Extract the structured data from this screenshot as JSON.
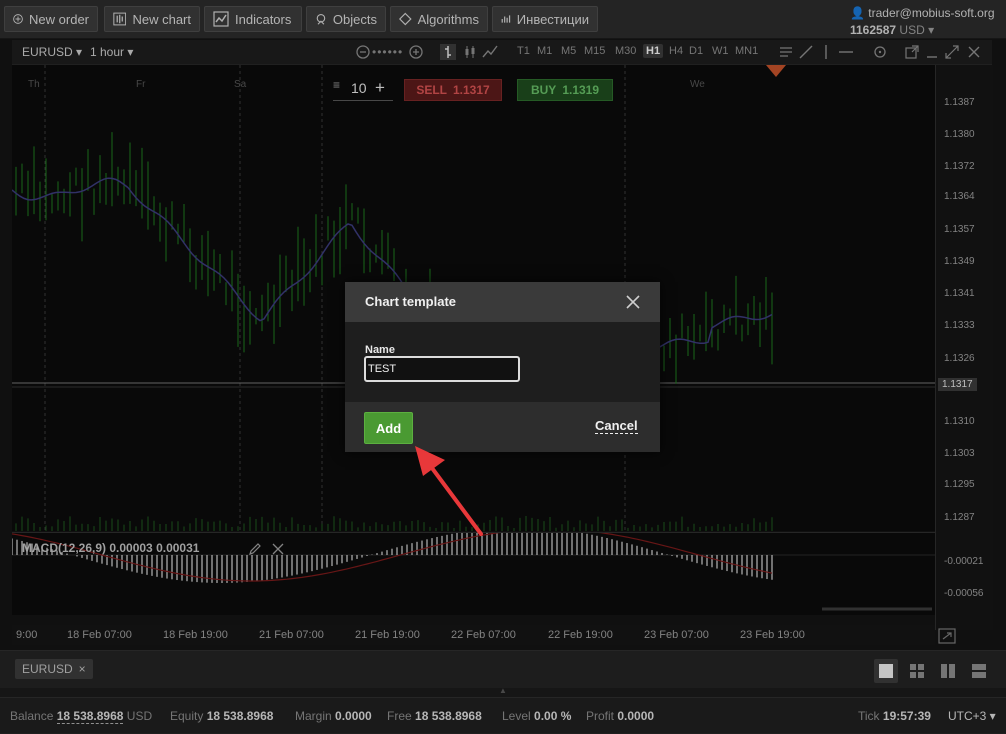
{
  "toolbar": {
    "new_order": "New order",
    "new_chart": "New chart",
    "indicators": "Indicators",
    "objects": "Objects",
    "algorithms": "Algorithms",
    "investments": "Инвестиции"
  },
  "account": {
    "email": "trader@mobius-soft.org",
    "number": "1162587",
    "currency": "USD"
  },
  "chart": {
    "symbol": "EURUSD",
    "interval": "1 hour",
    "timeframes": [
      "T1",
      "M1",
      "M5",
      "M15",
      "M30",
      "H1",
      "H4",
      "D1",
      "W1",
      "MN1"
    ],
    "active_timeframe": "H1",
    "day_labels": [
      "Th",
      "Fr",
      "Sa",
      "We"
    ],
    "price_labels": [
      "1.1387",
      "1.1380",
      "1.1372",
      "1.1364",
      "1.1357",
      "1.1349",
      "1.1341",
      "1.1333",
      "1.1326",
      "1.1310",
      "1.1303",
      "1.1295",
      "1.1287"
    ],
    "current_price": "1.1317",
    "macd_label": "MACD(12,26,9) 0.00003 0.00031",
    "macd_ticks": [
      "-0.00021",
      "-0.00056"
    ],
    "time_labels": [
      "9:00",
      "18 Feb 07:00",
      "18 Feb 19:00",
      "21 Feb 07:00",
      "21 Feb 19:00",
      "22 Feb 07:00",
      "22 Feb 19:00",
      "23 Feb 07:00",
      "23 Feb 19:00"
    ],
    "volume": "10",
    "sell_label": "SELL",
    "sell_price": "1.1317",
    "buy_label": "BUY",
    "buy_price": "1.1319"
  },
  "dialog": {
    "title": "Chart template",
    "name_label": "Name",
    "name_value": "TEST",
    "add": "Add",
    "cancel": "Cancel"
  },
  "tabs": {
    "symbol": "EURUSD"
  },
  "status": {
    "balance_label": "Balance",
    "balance": "18 538.8968",
    "balance_cur": "USD",
    "equity_label": "Equity",
    "equity": "18 538.8968",
    "margin_label": "Margin",
    "margin": "0.0000",
    "free_label": "Free",
    "free": "18 538.8968",
    "level_label": "Level",
    "level": "0.00 %",
    "profit_label": "Profit",
    "profit": "0.0000",
    "tick_label": "Tick",
    "time": "19:57:39",
    "timezone": "UTC+3"
  },
  "colors": {
    "sell": "#d05050",
    "buy": "#64b864",
    "add_button": "#4a9a32",
    "arrow": "#e8383a"
  }
}
